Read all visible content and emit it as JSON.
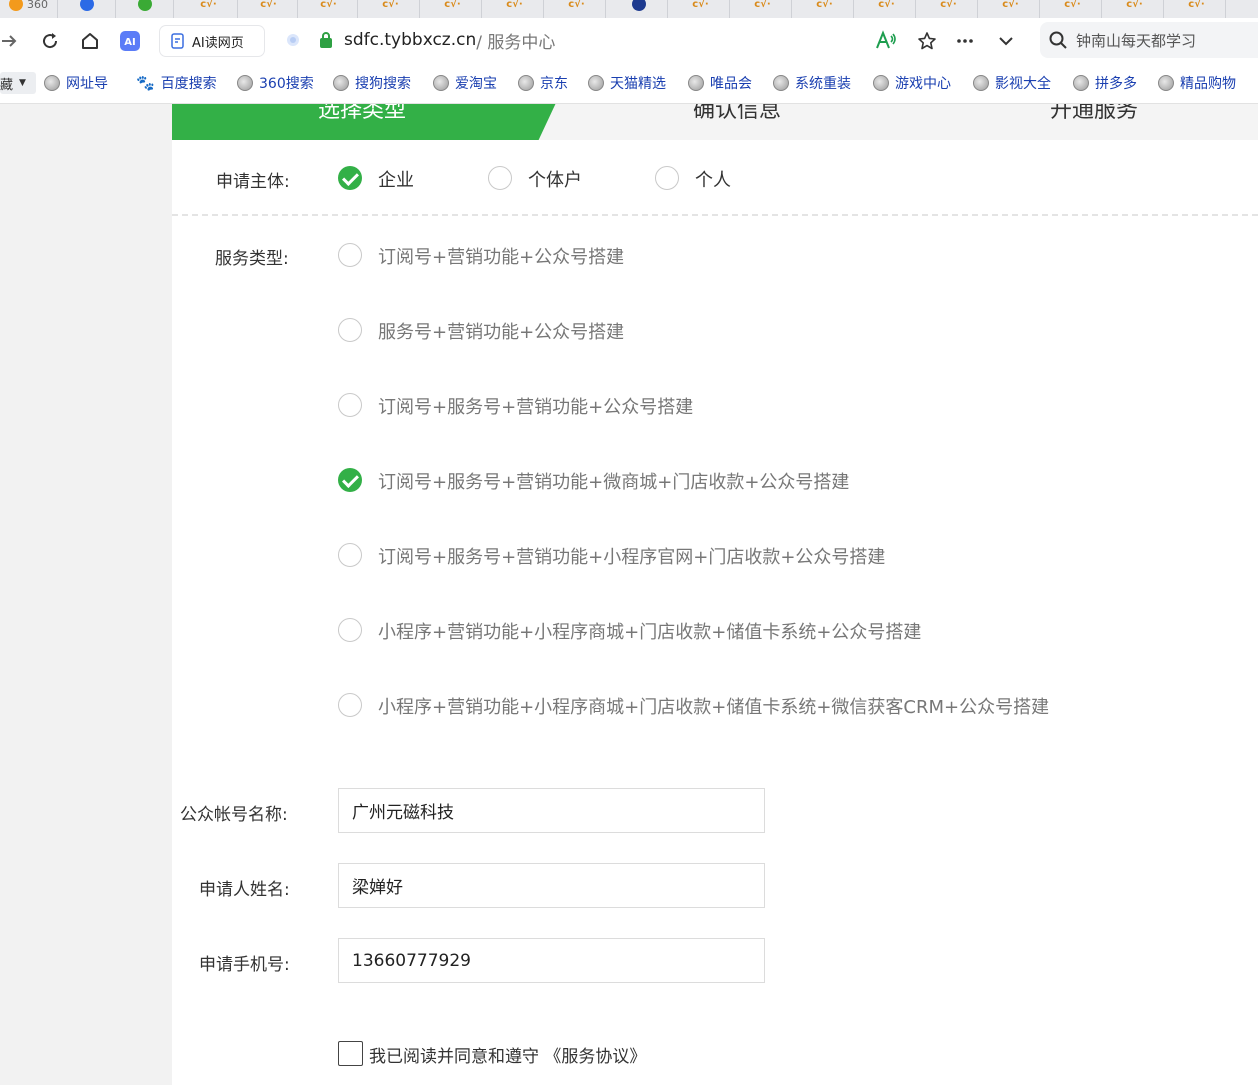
{
  "browser": {
    "tabs": [
      "360",
      "",
      "",
      "",
      "",
      "",
      "",
      "",
      "",
      "",
      "",
      "",
      "",
      "",
      "",
      "",
      "",
      "",
      "",
      ""
    ],
    "ai_read_label": "AI读网页",
    "url_host": "sdfc.tybbxcz.cn",
    "url_path": " / 服务中心",
    "search_text": "钟南山每天都学习"
  },
  "bookmarks": {
    "first": "藏",
    "items": [
      "网址导",
      "百度搜索",
      "360搜索",
      "搜狗搜索",
      "爱淘宝",
      "京东",
      "天猫精选",
      "唯品会",
      "系统重装",
      "游戏中心",
      "影视大全",
      "拼多多",
      "精品购物"
    ]
  },
  "steps": [
    "选择类型",
    "确认信息",
    "开通服务"
  ],
  "form": {
    "subject_label": "申请主体:",
    "subjects": [
      {
        "label": "企业",
        "checked": true
      },
      {
        "label": "个体户",
        "checked": false
      },
      {
        "label": "个人",
        "checked": false
      }
    ],
    "service_label": "服务类型:",
    "services": [
      {
        "label": "订阅号+营销功能+公众号搭建",
        "checked": false
      },
      {
        "label": "服务号+营销功能+公众号搭建",
        "checked": false
      },
      {
        "label": "订阅号+服务号+营销功能+公众号搭建",
        "checked": false
      },
      {
        "label": "订阅号+服务号+营销功能+微商城+门店收款+公众号搭建",
        "checked": true
      },
      {
        "label": "订阅号+服务号+营销功能+小程序官网+门店收款+公众号搭建",
        "checked": false
      },
      {
        "label": "小程序+营销功能+小程序商城+门店收款+储值卡系统+公众号搭建",
        "checked": false
      },
      {
        "label": "小程序+营销功能+小程序商城+门店收款+储值卡系统+微信获客CRM+公众号搭建",
        "checked": false
      }
    ],
    "account_name_label": "公众帐号名称:",
    "account_name_value": "广州元磁科技",
    "applicant_label": "申请人姓名:",
    "applicant_value": "梁婵好",
    "phone_label": "申请手机号:",
    "phone_value": "13660777929",
    "agree_text": "我已阅读并同意和遵守 《服务协议》"
  },
  "colors": {
    "accent": "#33b047",
    "link": "#1a3fb0"
  }
}
